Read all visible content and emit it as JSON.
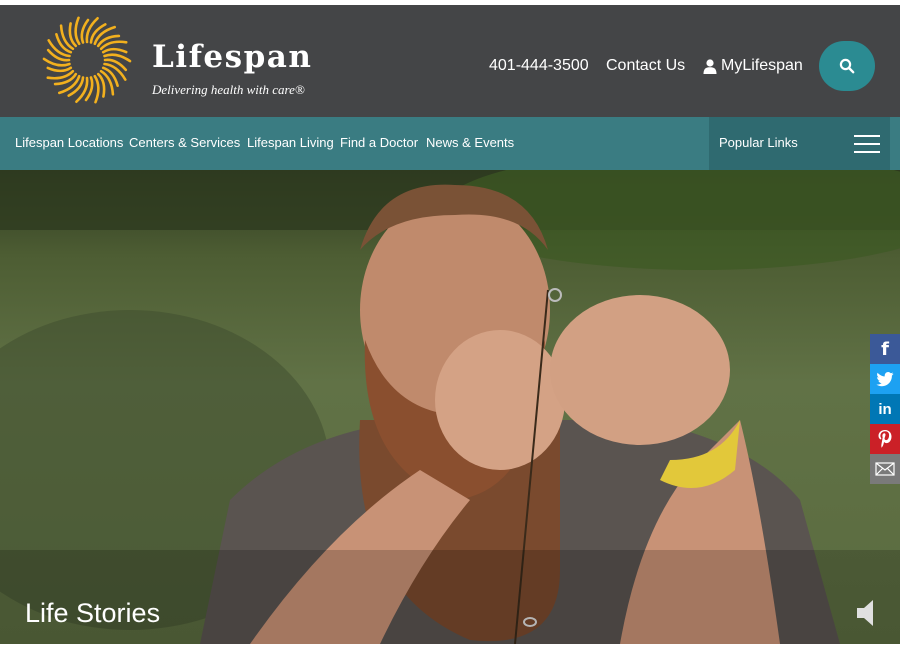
{
  "brand": {
    "name": "Lifespan",
    "tagline": "Delivering health with care®",
    "accent_color": "#f2b01e"
  },
  "header": {
    "phone": "401-444-3500",
    "contact_label": "Contact Us",
    "mylifespan_label": "MyLifespan",
    "search_icon": "search-icon",
    "background_color": "#444547"
  },
  "nav": {
    "items": [
      {
        "label": "Lifespan Locations"
      },
      {
        "label": "Centers & Services"
      },
      {
        "label": "Lifespan Living"
      },
      {
        "label": "Find a Doctor"
      },
      {
        "label": "News & Events"
      }
    ],
    "popular_links_label": "Popular Links",
    "background_color": "#3a7c82"
  },
  "hero": {
    "title": "Life Stories",
    "sound_icon": "speaker-muted-icon"
  },
  "share": {
    "buttons": [
      {
        "icon": "facebook-icon",
        "glyph": "f",
        "color": "#3b5998"
      },
      {
        "icon": "twitter-icon",
        "glyph": "✈",
        "color": "#1da1f2"
      },
      {
        "icon": "linkedin-icon",
        "glyph": "in",
        "color": "#0077b5"
      },
      {
        "icon": "pinterest-icon",
        "glyph": "P",
        "color": "#cb2027"
      },
      {
        "icon": "email-icon",
        "glyph": "✉",
        "color": "#7a7a7a"
      }
    ]
  }
}
